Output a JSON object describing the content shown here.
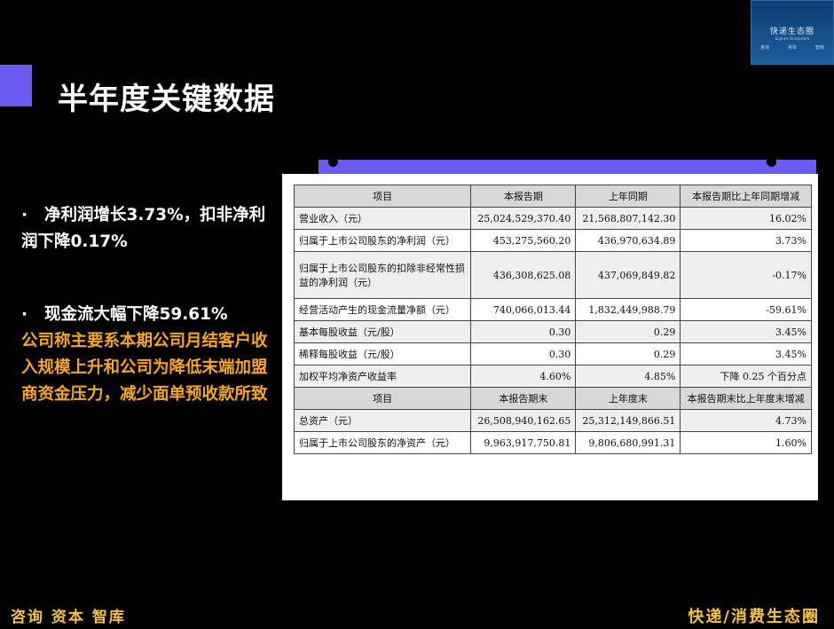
{
  "title": "半年度关键数据",
  "logo": {
    "name": "快递生态圈",
    "subtitle": "Express Ecosystem",
    "tags": [
      "咨询",
      "资本",
      "智库"
    ]
  },
  "bullets": {
    "b1": "净利润增长3.73%，扣非净利润下降0.17%",
    "b2": "现金流大幅下降59.61%",
    "b2_detail": "公司称主要系本期公司月结客户收入规模上升和公司为降低末端加盟商资金压力，减少面单预收款所致"
  },
  "table": {
    "headers": [
      "项目",
      "本报告期",
      "上年同期",
      "本报告期比上年同期增减"
    ],
    "rows": [
      [
        "营业收入（元）",
        "25,024,529,370.40",
        "21,568,807,142.30",
        "16.02%"
      ],
      [
        "归属于上市公司股东的净利润（元）",
        "453,275,560.20",
        "436,970,634.89",
        "3.73%"
      ],
      [
        "归属于上市公司股东的扣除非经常性损益的净利润（元）",
        "436,308,625.08",
        "437,069,849.82",
        "-0.17%"
      ],
      [
        "经营活动产生的现金流量净额（元）",
        "740,066,013.44",
        "1,832,449,988.79",
        "-59.61%"
      ],
      [
        "基本每股收益（元/股）",
        "0.30",
        "0.29",
        "3.45%"
      ],
      [
        "稀释每股收益（元/股）",
        "0.30",
        "0.29",
        "3.45%"
      ],
      [
        "加权平均净资产收益率",
        "4.60%",
        "4.85%",
        "下降 0.25 个百分点"
      ]
    ],
    "headers2": [
      "项目",
      "本报告期末",
      "上年度末",
      "本报告期末比上年度末增减"
    ],
    "rows2": [
      [
        "总资产（元）",
        "26,508,940,162.65",
        "25,312,149,866.51",
        "4.73%"
      ],
      [
        "归属于上市公司股东的净资产（元）",
        "9,963,917,750.81",
        "9,806,680,991.31",
        "1.60%"
      ]
    ]
  },
  "footer": {
    "left": "咨询 资本 智库",
    "right": "快递/消费生态圈"
  }
}
